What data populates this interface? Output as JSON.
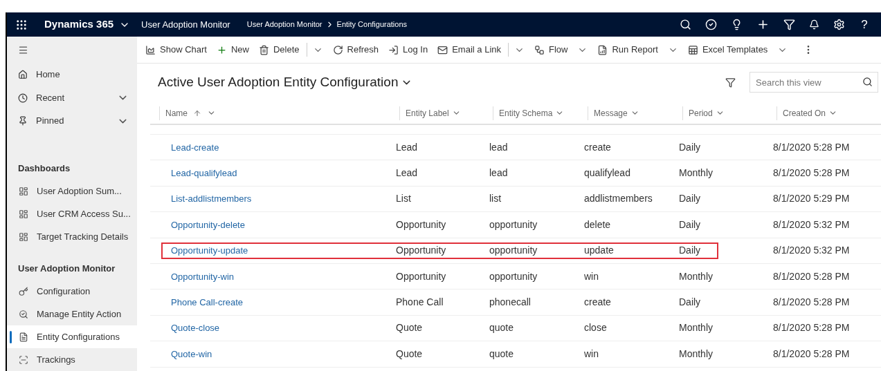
{
  "top_bar": {
    "app_name": "Dynamics 365",
    "area": "User Adoption Monitor",
    "breadcrumb": [
      "User Adoption Monitor",
      "Entity Configurations"
    ],
    "help": "?"
  },
  "sidebar": {
    "nav": [
      {
        "label": "Home",
        "expandable": false
      },
      {
        "label": "Recent",
        "expandable": true
      },
      {
        "label": "Pinned",
        "expandable": true
      }
    ],
    "groups": [
      {
        "heading": "Dashboards",
        "items": [
          {
            "label": "User Adoption Sum...",
            "selected": false
          },
          {
            "label": "User CRM Access Su...",
            "selected": false
          },
          {
            "label": "Target Tracking Details",
            "selected": false
          }
        ]
      },
      {
        "heading": "User Adoption Monitor",
        "items": [
          {
            "label": "Configuration",
            "selected": false
          },
          {
            "label": "Manage Entity Action",
            "selected": false
          },
          {
            "label": "Entity Configurations",
            "selected": true
          },
          {
            "label": "Trackings",
            "selected": false
          }
        ]
      }
    ]
  },
  "command_bar": [
    {
      "label": "Show Chart",
      "kind": "plain"
    },
    {
      "label": "New",
      "kind": "plain"
    },
    {
      "label": "Delete",
      "kind": "split"
    },
    {
      "label": "Refresh",
      "kind": "plain"
    },
    {
      "label": "Log In",
      "kind": "plain"
    },
    {
      "label": "Email a Link",
      "kind": "split"
    },
    {
      "label": "Flow",
      "kind": "dropdown"
    },
    {
      "label": "Run Report",
      "kind": "dropdown"
    },
    {
      "label": "Excel Templates",
      "kind": "dropdown"
    }
  ],
  "view": {
    "title": "Active User Adoption Entity Configuration",
    "search": {
      "placeholder": "Search this view"
    }
  },
  "table": {
    "columns": [
      {
        "label": "Name",
        "sorted": true
      },
      {
        "label": "Entity Label",
        "sorted": false
      },
      {
        "label": "Entity Schema",
        "sorted": false
      },
      {
        "label": "Message",
        "sorted": false
      },
      {
        "label": "Period",
        "sorted": false
      },
      {
        "label": "Created On",
        "sorted": false
      }
    ],
    "rows": [
      {
        "cells": [
          "Lead-create",
          "Lead",
          "lead",
          "create",
          "Daily",
          "8/1/2020 5:28 PM"
        ],
        "highlighted": false
      },
      {
        "cells": [
          "Lead-qualifylead",
          "Lead",
          "lead",
          "qualifylead",
          "Monthly",
          "8/1/2020 5:28 PM"
        ],
        "highlighted": false
      },
      {
        "cells": [
          "List-addlistmembers",
          "List",
          "list",
          "addlistmembers",
          "Daily",
          "8/1/2020 5:29 PM"
        ],
        "highlighted": false
      },
      {
        "cells": [
          "Opportunity-delete",
          "Opportunity",
          "opportunity",
          "delete",
          "Daily",
          "8/1/2020 5:32 PM"
        ],
        "highlighted": false
      },
      {
        "cells": [
          "Opportunity-update",
          "Opportunity",
          "opportunity",
          "update",
          "Daily",
          "8/1/2020 5:32 PM"
        ],
        "highlighted": true
      },
      {
        "cells": [
          "Opportunity-win",
          "Opportunity",
          "opportunity",
          "win",
          "Monthly",
          "8/1/2020 5:28 PM"
        ],
        "highlighted": false
      },
      {
        "cells": [
          "Phone Call-create",
          "Phone Call",
          "phonecall",
          "create",
          "Daily",
          "8/1/2020 5:28 PM"
        ],
        "highlighted": false
      },
      {
        "cells": [
          "Quote-close",
          "Quote",
          "quote",
          "close",
          "Monthly",
          "8/1/2020 5:28 PM"
        ],
        "highlighted": false
      },
      {
        "cells": [
          "Quote-win",
          "Quote",
          "quote",
          "win",
          "Monthly",
          "8/1/2020 5:28 PM"
        ],
        "highlighted": false
      }
    ]
  }
}
